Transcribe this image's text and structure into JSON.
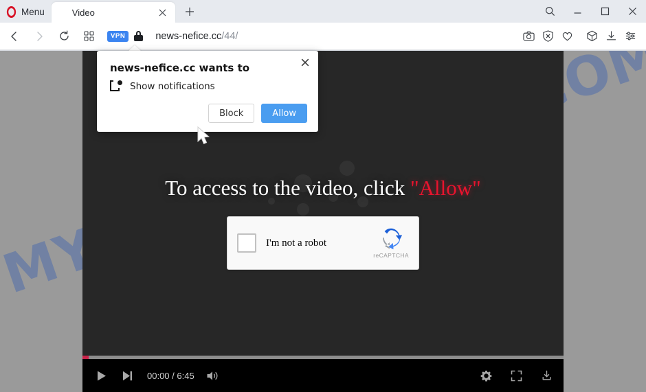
{
  "browser": {
    "menu_label": "Menu",
    "menu_icon": "opera-logo-icon",
    "tab": {
      "title": "Video",
      "close_icon": "close-icon"
    },
    "new_tab_icon": "plus-icon",
    "window_controls": [
      {
        "name": "search-icon",
        "glyph": "search"
      },
      {
        "name": "minimize-icon",
        "glyph": "minimize"
      },
      {
        "name": "maximize-icon",
        "glyph": "maximize"
      },
      {
        "name": "close-window-icon",
        "glyph": "close"
      }
    ],
    "nav": {
      "back_icon": "back-arrow-icon",
      "forward_icon": "forward-arrow-icon",
      "reload_icon": "reload-icon",
      "speeddial_icon": "speed-dial-icon"
    },
    "address": {
      "vpn_badge": "VPN",
      "lock_icon": "lock-icon",
      "domain": "news-nefice.cc",
      "path": "/44/",
      "full_url": "news-nefice.cc/44/"
    },
    "toolbar_icons": [
      {
        "name": "snapshot-icon"
      },
      {
        "name": "ad-blocker-shield-icon"
      },
      {
        "name": "heart-icon"
      },
      {
        "name": "extensions-cube-icon"
      },
      {
        "name": "downloads-icon"
      },
      {
        "name": "easy-setup-icon"
      }
    ]
  },
  "page": {
    "watermark": "MYANTISPYWARE.COM",
    "headline_prefix": "To access to the video, click ",
    "headline_highlight": "\"Allow\"",
    "recaptcha": {
      "label": "I'm not a robot",
      "brand": "reCAPTCHA",
      "checkbox_checked": false
    },
    "player": {
      "play_icon": "play-icon",
      "next_icon": "next-track-icon",
      "time": "00:00 / 6:45",
      "current_time": "00:00",
      "duration": "6:45",
      "volume_icon": "volume-icon",
      "settings_icon": "gear-icon",
      "fullscreen_icon": "fullscreen-icon",
      "download_icon": "download-icon",
      "progress_percent": 1.3
    }
  },
  "dialog": {
    "title": "news-nefice.cc wants to",
    "permission_icon": "notification-permission-icon",
    "permission_label": "Show notifications",
    "block_label": "Block",
    "allow_label": "Allow",
    "close_icon": "close-icon"
  },
  "colors": {
    "accent_blue": "#4a9df0",
    "vpn_blue": "#3b84f0",
    "highlight_red": "#e8142e",
    "progress_red": "#c9234a",
    "video_bg": "#272727",
    "page_bg": "#9a9a9a",
    "watermark_blue": "#3a60b0"
  }
}
